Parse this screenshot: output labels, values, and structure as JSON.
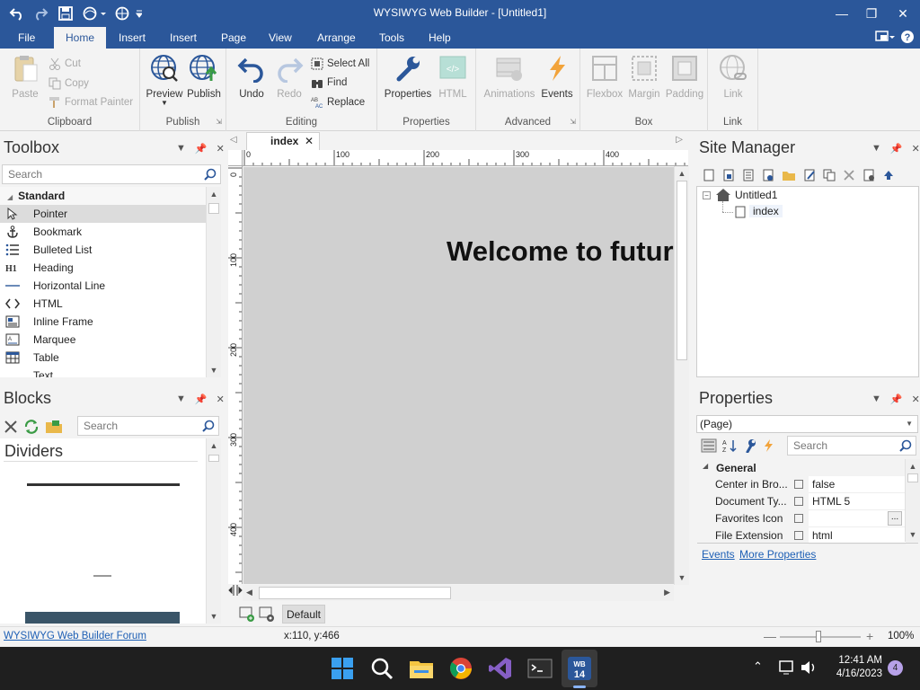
{
  "window": {
    "title": "WYSIWYG Web Builder - [Untitled1]"
  },
  "menu_tabs": [
    "File",
    "Home",
    "Insert",
    "Insert",
    "Page",
    "View",
    "Arrange",
    "Tools",
    "Help"
  ],
  "ribbon": {
    "clipboard": {
      "paste": "Paste",
      "cut": "Cut",
      "copy": "Copy",
      "format_painter": "Format Painter",
      "label": "Clipboard"
    },
    "publish": {
      "preview": "Preview",
      "publish": "Publish",
      "label": "Publish"
    },
    "editing": {
      "undo": "Undo",
      "redo": "Redo",
      "select_all": "Select All",
      "find": "Find",
      "replace": "Replace",
      "label": "Editing"
    },
    "properties": {
      "properties": "Properties",
      "html": "HTML",
      "label": "Properties"
    },
    "advanced": {
      "animations": "Animations",
      "events": "Events",
      "label": "Advanced"
    },
    "box": {
      "flexbox": "Flexbox",
      "margin": "Margin",
      "padding": "Padding",
      "label": "Box"
    },
    "link": {
      "link": "Link",
      "label": "Link"
    }
  },
  "toolbox": {
    "title": "Toolbox",
    "search_placeholder": "Search",
    "section": "Standard",
    "items": [
      "Pointer",
      "Bookmark",
      "Bulleted List",
      "Heading",
      "Horizontal Line",
      "HTML",
      "Inline Frame",
      "Marquee",
      "Table",
      "Text"
    ]
  },
  "blocks": {
    "title": "Blocks",
    "search_placeholder": "Search",
    "category": "Dividers"
  },
  "editor": {
    "tab": "index",
    "ruler_h": [
      "0",
      "100",
      "200",
      "300",
      "400"
    ],
    "ruler_v": [
      "0",
      "100",
      "200",
      "300",
      "400"
    ],
    "heading": "Welcome to futur",
    "layout_button": "Default"
  },
  "site_manager": {
    "title": "Site Manager",
    "root": "Untitled1",
    "page": "index"
  },
  "properties": {
    "title": "Properties",
    "selector": "(Page)",
    "search_placeholder": "Search",
    "section": "General",
    "rows": [
      {
        "name": "Center in Bro...",
        "value": "false"
      },
      {
        "name": "Document Ty...",
        "value": "HTML 5"
      },
      {
        "name": "Favorites Icon",
        "value": ""
      },
      {
        "name": "File Extension",
        "value": "html"
      }
    ],
    "links": {
      "events": "Events",
      "more": "More Properties"
    }
  },
  "status": {
    "forum": "WYSIWYG Web Builder Forum",
    "coords": "x:110, y:466",
    "zoom": "100%"
  },
  "taskbar": {
    "time": "12:41 AM",
    "date": "4/16/2023",
    "notif_count": "4"
  }
}
